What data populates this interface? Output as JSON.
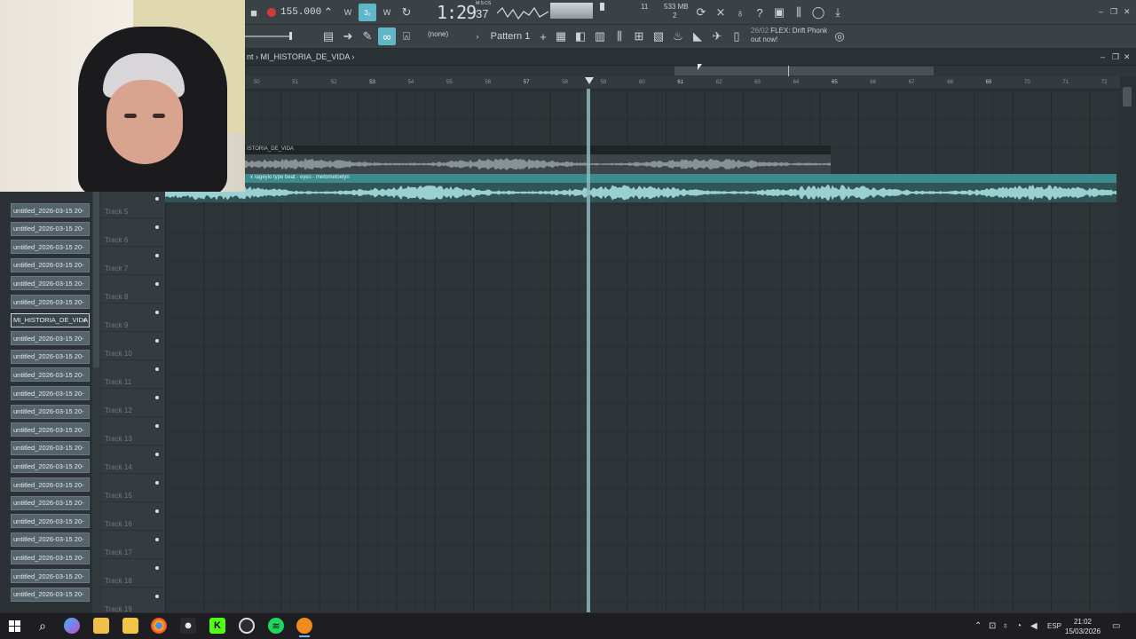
{
  "toolbar": {
    "tempo": "155.000",
    "time": "1:29",
    "time_sub": "37",
    "time_label": "M:S:CS",
    "cpu": "11",
    "memory": "533 MB",
    "memory_count": "2",
    "snap": "(none)",
    "pattern": "Pattern 1",
    "news_date": "26/02",
    "news_text": "FLEX: Drift Phonk out now!"
  },
  "playlist": {
    "breadcrumb": "nt › MI_HISTORIA_DE_VIDA ›",
    "ruler_ticks": [
      {
        "label": "50",
        "major": false
      },
      {
        "label": "51",
        "major": false
      },
      {
        "label": "52",
        "major": false
      },
      {
        "label": "53",
        "major": true
      },
      {
        "label": "54",
        "major": false
      },
      {
        "label": "55",
        "major": false
      },
      {
        "label": "56",
        "major": false
      },
      {
        "label": "57",
        "major": true
      },
      {
        "label": "58",
        "major": false
      },
      {
        "label": "59",
        "major": false
      },
      {
        "label": "60",
        "major": false
      },
      {
        "label": "61",
        "major": true
      },
      {
        "label": "62",
        "major": false
      },
      {
        "label": "63",
        "major": false
      },
      {
        "label": "64",
        "major": false
      },
      {
        "label": "65",
        "major": true
      },
      {
        "label": "66",
        "major": false
      },
      {
        "label": "67",
        "major": false
      },
      {
        "label": "68",
        "major": false
      },
      {
        "label": "69",
        "major": true
      },
      {
        "label": "70",
        "major": false
      },
      {
        "label": "71",
        "major": false
      },
      {
        "label": "72",
        "major": false
      }
    ],
    "clips": [
      {
        "label": "ISTORIA_DE_VIDA",
        "color": "#1f2426"
      },
      {
        "label": "x rageyio type beat - eyes - metometoelyn",
        "color": "#3a8a8e"
      }
    ],
    "tracks": [
      "Track 5",
      "Track 6",
      "Track 7",
      "Track 8",
      "Track 9",
      "Track 10",
      "Track 11",
      "Track 12",
      "Track 13",
      "Track 14",
      "Track 15",
      "Track 16",
      "Track 17",
      "Track 18",
      "Track 19"
    ]
  },
  "browser": {
    "items": [
      "untitled_2026-03-15 20-",
      "untitled_2026-03-15 20-",
      "untitled_2026-03-15 20-",
      "untitled_2026-03-15 20-",
      "untitled_2026-03-15 20-",
      "untitled_2026-03-15 20-",
      "MI_HISTORIA_DE_VIDA",
      "untitled_2026-03-15 20-",
      "untitled_2026-03-15 20-",
      "untitled_2026-03-15 20-",
      "untitled_2026-03-15 20-",
      "untitled_2026-03-15 20-",
      "untitled_2026-03-15 20-",
      "untitled_2026-03-15 20-",
      "untitled_2026-03-15 20-",
      "untitled_2026-03-15 20-",
      "untitled_2026-03-15 20-",
      "untitled_2026-03-15 20-",
      "untitled_2026-03-15 20-",
      "untitled_2026-03-15 20-",
      "untitled_2026-03-15 20-",
      "untitled_2026-03-15 20-"
    ],
    "selected_index": 6,
    "selected_plus": "+"
  },
  "taskbar": {
    "language": "ESP",
    "time": "21:02",
    "date": "15/03/2026"
  },
  "colors": {
    "accent": "#5fb7c9",
    "clip_teal": "#3a8a8e",
    "waveform_teal": "#9bd0d2",
    "record_red": "#d23a3a"
  }
}
